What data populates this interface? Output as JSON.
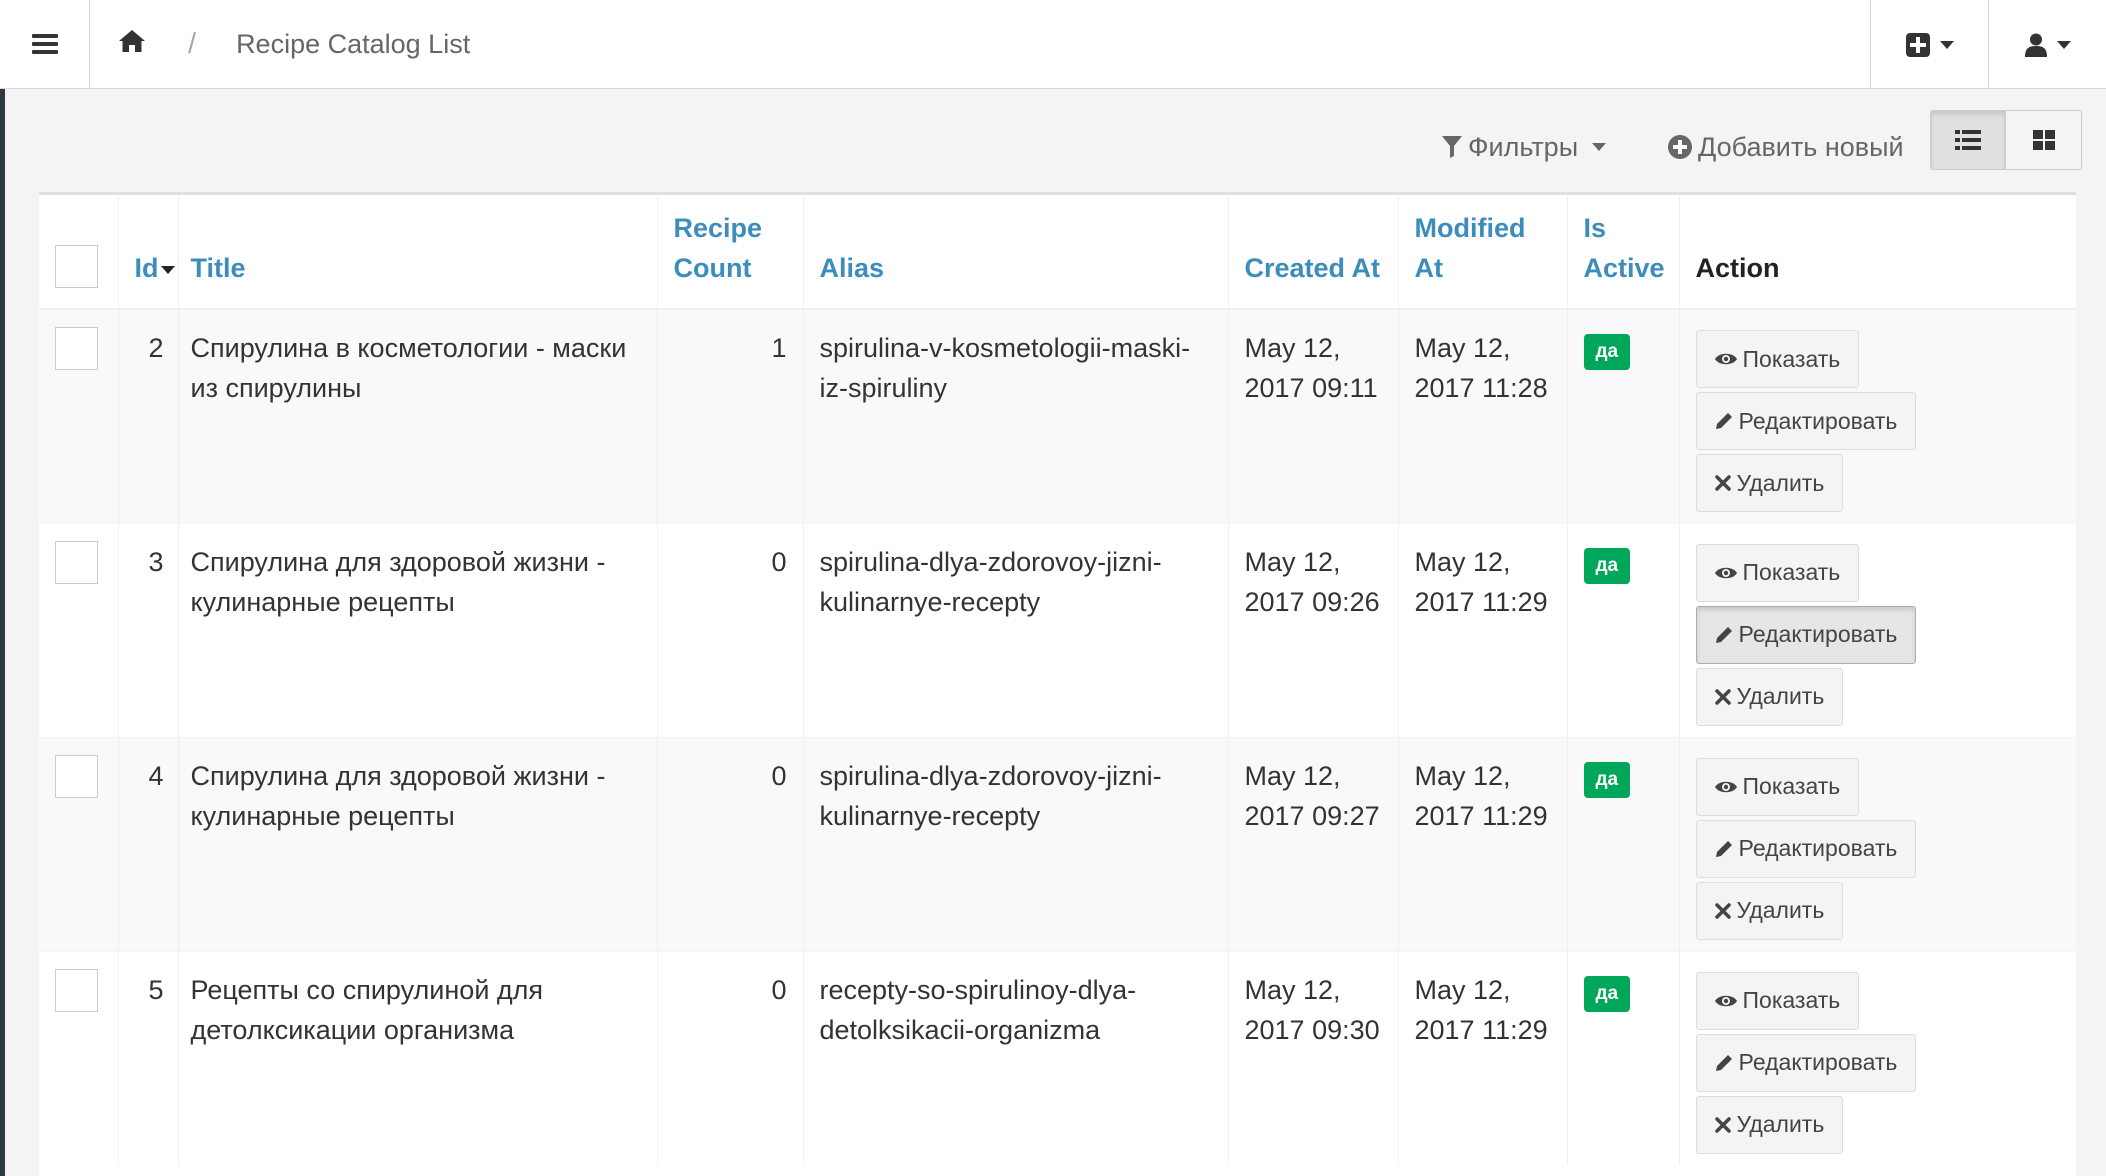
{
  "header": {
    "menu_icon": "bars-icon",
    "home_icon": "home-icon",
    "separator": "/",
    "current_page": "Recipe Catalog List",
    "add_icon": "plus-square-icon",
    "user_icon": "user-icon"
  },
  "toolbar": {
    "filter_label": "Фильтры",
    "add_label": "Добавить новый",
    "list_view_icon": "list-icon",
    "grid_view_icon": "grid-icon"
  },
  "table": {
    "headers": {
      "id": "Id",
      "title": "Title",
      "recipe_count_1": "Recipe",
      "recipe_count_2": "Count",
      "alias": "Alias",
      "created_at": "Created At",
      "modified_at_1": "Modified",
      "modified_at_2": "At",
      "is_active_1": "Is",
      "is_active_2": "Active",
      "action": "Action"
    },
    "rows": [
      {
        "id": "2",
        "title_1": "Спирулина в косметологии - маски",
        "title_2": "из спирулины",
        "recipe_count": "1",
        "alias_1": "spirulina-v-kosmetologii-maski-",
        "alias_2": "iz-spiruliny",
        "created_1": "May 12,",
        "created_2": "2017 09:11",
        "modified_1": "May 12,",
        "modified_2": "2017 11:28",
        "active": "да"
      },
      {
        "id": "3",
        "title_1": "Спирулина для здоровой жизни -",
        "title_2": "кулинарные рецепты",
        "recipe_count": "0",
        "alias_1": "spirulina-dlya-zdorovoy-jizni-",
        "alias_2": "kulinarnye-recepty",
        "created_1": "May 12,",
        "created_2": "2017 09:26",
        "modified_1": "May 12,",
        "modified_2": "2017 11:29",
        "active": "да"
      },
      {
        "id": "4",
        "title_1": "Спирулина для здоровой жизни -",
        "title_2": "кулинарные рецепты",
        "recipe_count": "0",
        "alias_1": "spirulina-dlya-zdorovoy-jizni-",
        "alias_2": "kulinarnye-recepty",
        "created_1": "May 12,",
        "created_2": "2017 09:27",
        "modified_1": "May 12,",
        "modified_2": "2017 11:29",
        "active": "да"
      },
      {
        "id": "5",
        "title_1": "Рецепты со спирулиной для",
        "title_2": "детолксикации организма",
        "recipe_count": "0",
        "alias_1": "recepty-so-spirulinoy-dlya-",
        "alias_2": "detolksikacii-organizma",
        "created_1": "May 12,",
        "created_2": "2017 09:30",
        "modified_1": "May 12,",
        "modified_2": "2017 11:29",
        "active": "да"
      }
    ],
    "actions": {
      "show": "Показать",
      "edit": "Редактировать",
      "delete": "Удалить"
    }
  },
  "colors": {
    "link": "#3c8dbc",
    "active_badge": "#00a65a"
  }
}
